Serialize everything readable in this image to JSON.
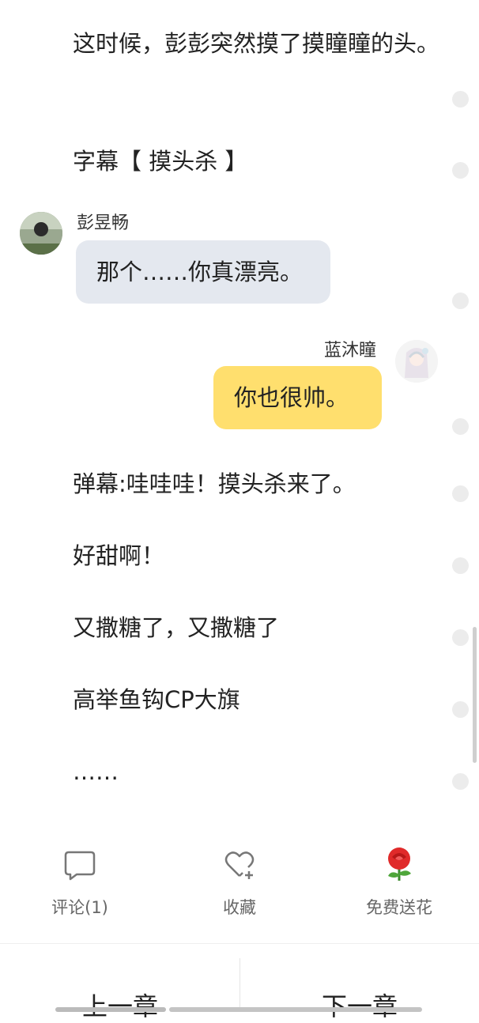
{
  "story": {
    "paragraph_1": "这时候，彭彭突然摸了摸瞳瞳的头。",
    "paragraph_2": "字幕【 摸头杀 】",
    "chat": [
      {
        "sender": "彭昱畅",
        "text": "那个……你真漂亮。",
        "side": "left",
        "bubble_color": "#e4e8ef"
      },
      {
        "sender": "蓝沐瞳",
        "text": "你也很帅。",
        "side": "right",
        "bubble_color": "#ffdf6e"
      }
    ],
    "lines": [
      "弹幕:哇哇哇！摸头杀来了。",
      "好甜啊！",
      "又撒糖了，又撒糖了",
      "高举鱼钩CP大旗",
      "……"
    ]
  },
  "actions": {
    "comment_label": "评论(1)",
    "favorite_label": "收藏",
    "flower_label": "免费送花"
  },
  "nav": {
    "prev_label": "上一章",
    "next_label": "下一章"
  },
  "icons": {
    "comment": "speech-bubble-icon",
    "favorite": "heart-plus-icon",
    "flower": "rose-icon"
  }
}
